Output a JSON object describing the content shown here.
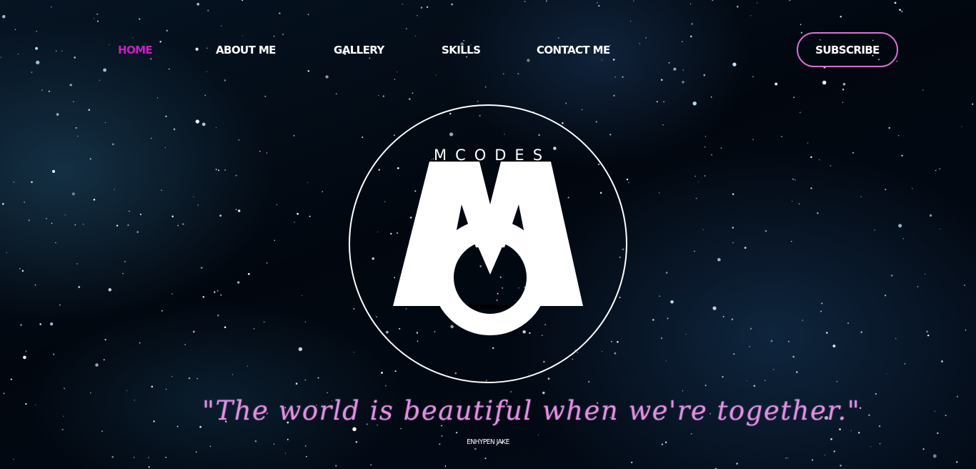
{
  "nav": {
    "items": [
      {
        "label": "HOME",
        "active": true
      },
      {
        "label": "ABOUT ME",
        "active": false
      },
      {
        "label": "GALLERY",
        "active": false
      },
      {
        "label": "SKILLS",
        "active": false
      },
      {
        "label": "CONTACT ME",
        "active": false
      }
    ],
    "subscribe_label": "SUBSCRIBE"
  },
  "logo": {
    "brand_text": "MCODES",
    "monogram": "MO"
  },
  "hero": {
    "quote": "\"The world is beautiful when we're together.\"",
    "attribution": "ENHYPEN JAKE"
  },
  "colors": {
    "accent": "#c81fc4",
    "subscribe_border": "#d970d4",
    "quote": "#e08fe0",
    "background": "#01040c"
  }
}
